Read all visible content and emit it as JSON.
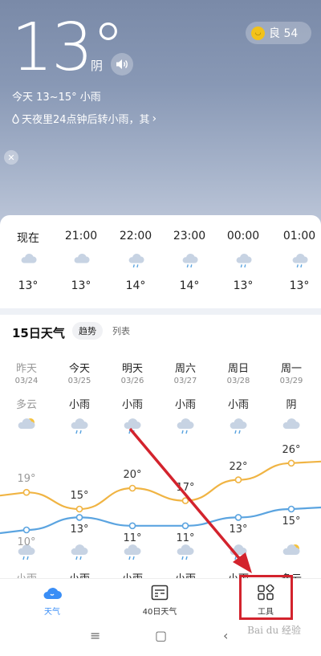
{
  "header": {
    "temperature": "13°",
    "condition": "阴",
    "aqi_label": "良 54",
    "today_range": "今天 13~15°   小雨",
    "alert_text": "天夜里24点钟后转小雨，其",
    "speaker_icon": "speaker-icon",
    "close_icon": "close-icon"
  },
  "hourly": [
    {
      "time": "现在",
      "temp": "13°",
      "icon": "cloudy-icon"
    },
    {
      "time": "21:00",
      "temp": "13°",
      "icon": "cloudy-icon"
    },
    {
      "time": "22:00",
      "temp": "14°",
      "icon": "light-rain-icon"
    },
    {
      "time": "23:00",
      "temp": "14°",
      "icon": "light-rain-icon"
    },
    {
      "time": "00:00",
      "temp": "13°",
      "icon": "light-rain-icon"
    },
    {
      "time": "01:00",
      "temp": "13°",
      "icon": "light-rain-icon"
    }
  ],
  "daily_section": {
    "title": "15日天气",
    "tab_trend": "趋势",
    "tab_list": "列表"
  },
  "daily": [
    {
      "name": "昨天",
      "date": "03/24",
      "cond": "多云",
      "high": "19°",
      "low": "10°",
      "night_cond": "小雨",
      "past": true
    },
    {
      "name": "今天",
      "date": "03/25",
      "cond": "小雨",
      "high": "15°",
      "low": "13°",
      "night_cond": "小雨",
      "past": false
    },
    {
      "name": "明天",
      "date": "03/26",
      "cond": "小雨",
      "high": "20°",
      "low": "11°",
      "night_cond": "小雨",
      "past": false
    },
    {
      "name": "周六",
      "date": "03/27",
      "cond": "小雨",
      "high": "17°",
      "low": "11°",
      "night_cond": "小雨",
      "past": false
    },
    {
      "name": "周日",
      "date": "03/28",
      "cond": "小雨",
      "high": "22°",
      "low": "13°",
      "night_cond": "小雨",
      "past": false
    },
    {
      "name": "周一",
      "date": "03/29",
      "cond": "阴",
      "high": "26°",
      "low": "15°",
      "night_cond": "多云",
      "past": false
    }
  ],
  "nav": {
    "weather": "天气",
    "forty_day": "40日天气",
    "tools": "工具"
  },
  "watermark": "Bai du 经验",
  "colors": {
    "accent": "#3a8ef6",
    "high_line": "#f0b443",
    "low_line": "#5ba4e0",
    "annotation": "#d3232d"
  }
}
